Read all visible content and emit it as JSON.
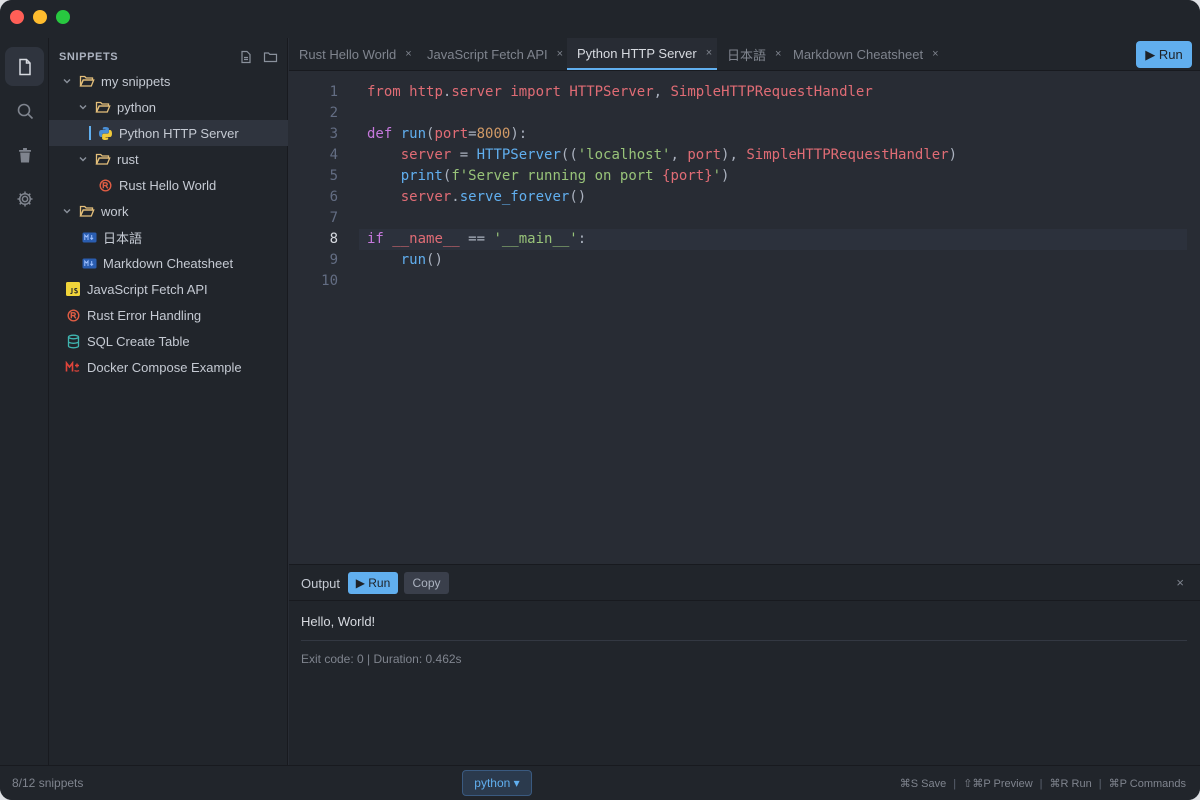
{
  "sidebar": {
    "title": "SNIPPETS",
    "tree": [
      {
        "label": "my snippets",
        "type": "folder",
        "depth": 0,
        "expanded": true
      },
      {
        "label": "python",
        "type": "folder",
        "depth": 1,
        "expanded": true
      },
      {
        "label": "Python HTTP Server",
        "type": "python",
        "depth": 2,
        "selected": true
      },
      {
        "label": "rust",
        "type": "folder",
        "depth": 1,
        "expanded": true
      },
      {
        "label": "Rust Hello World",
        "type": "rust",
        "depth": 2
      },
      {
        "label": "work",
        "type": "folder",
        "depth": 0,
        "expanded": true
      },
      {
        "label": "日本語",
        "type": "markdown",
        "depth": 1
      },
      {
        "label": "Markdown Cheatsheet",
        "type": "markdown",
        "depth": 1
      },
      {
        "label": "JavaScript Fetch API",
        "type": "javascript",
        "depth": 0
      },
      {
        "label": "Rust Error Handling",
        "type": "rust",
        "depth": 0
      },
      {
        "label": "SQL Create Table",
        "type": "sql",
        "depth": 0
      },
      {
        "label": "Docker Compose Example",
        "type": "docker",
        "depth": 0
      }
    ]
  },
  "tabs": [
    {
      "label": "Rust Hello World",
      "active": false
    },
    {
      "label": "JavaScript Fetch API",
      "active": false
    },
    {
      "label": "Python HTTP Server",
      "active": true
    },
    {
      "label": "日本語",
      "active": false
    },
    {
      "label": "Markdown Cheatsheet",
      "active": false
    }
  ],
  "toolbar": {
    "run_label": "▶ Run"
  },
  "editor": {
    "current_line": 8,
    "lines": [
      [
        [
          "t",
          "from "
        ],
        [
          "t",
          "http"
        ],
        [
          "pl",
          "."
        ],
        [
          "t",
          "server "
        ],
        [
          "t",
          "import "
        ],
        [
          "t",
          "HTTPServer"
        ],
        [
          "pl",
          ", "
        ],
        [
          "t",
          "SimpleHTTPRequestHandler"
        ]
      ],
      [],
      [
        [
          "k",
          "def "
        ],
        [
          "f",
          "run"
        ],
        [
          "pl",
          "("
        ],
        [
          "t",
          "port"
        ],
        [
          "pl",
          "="
        ],
        [
          "n",
          "8000"
        ],
        [
          "pl",
          "):"
        ]
      ],
      [
        [
          "pl",
          "    "
        ],
        [
          "t",
          "server "
        ],
        [
          "pl",
          "= "
        ],
        [
          "f",
          "HTTPServer"
        ],
        [
          "pl",
          "(("
        ],
        [
          "s",
          "'localhost'"
        ],
        [
          "pl",
          ", "
        ],
        [
          "t",
          "port"
        ],
        [
          "pl",
          "), "
        ],
        [
          "t",
          "SimpleHTTPRequestHandler"
        ],
        [
          "pl",
          ")"
        ]
      ],
      [
        [
          "pl",
          "    "
        ],
        [
          "f",
          "print"
        ],
        [
          "pl",
          "("
        ],
        [
          "s",
          "f'Server running on port "
        ],
        [
          "t",
          "{port}"
        ],
        [
          "s",
          "'"
        ],
        [
          "pl",
          ")"
        ]
      ],
      [
        [
          "pl",
          "    "
        ],
        [
          "t",
          "server"
        ],
        [
          "pl",
          "."
        ],
        [
          "f",
          "serve_forever"
        ],
        [
          "pl",
          "()"
        ]
      ],
      [],
      [
        [
          "k",
          "if "
        ],
        [
          "t",
          "__name__ "
        ],
        [
          "pl",
          "== "
        ],
        [
          "s",
          "'__main__'"
        ],
        [
          "pl",
          ":"
        ]
      ],
      [
        [
          "pl",
          "    "
        ],
        [
          "f",
          "run"
        ],
        [
          "pl",
          "()"
        ]
      ],
      []
    ]
  },
  "output": {
    "title": "Output",
    "run_label": "▶ Run",
    "copy_label": "Copy",
    "close_label": "×",
    "text": "Hello, World!",
    "meta": "Exit code: 0 | Duration: 0.462s"
  },
  "status": {
    "count": "8/12 snippets",
    "language": "python ▾",
    "shortcuts": [
      "⌘S Save",
      "⇧⌘P Preview",
      "⌘R Run",
      "⌘P Commands"
    ]
  },
  "colors": {
    "accent": "#61afef",
    "keyword": "#c678dd",
    "string": "#98c379",
    "number": "#d19a66",
    "identifier": "#e06c75"
  }
}
